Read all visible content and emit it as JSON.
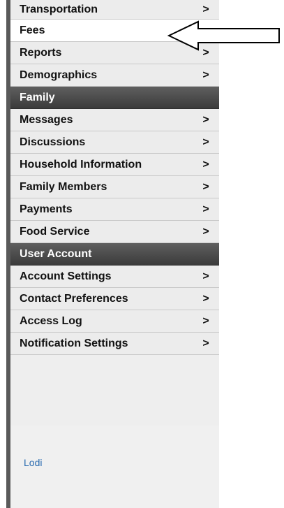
{
  "menu": {
    "top_items": [
      {
        "label": "Transportation",
        "chevron": ">"
      },
      {
        "label": "Fees",
        "chevron": ""
      },
      {
        "label": "Reports",
        "chevron": ">"
      },
      {
        "label": "Demographics",
        "chevron": ">"
      }
    ],
    "family_header": "Family",
    "family_items": [
      {
        "label": "Messages",
        "chevron": ">"
      },
      {
        "label": "Discussions",
        "chevron": ">"
      },
      {
        "label": "Household Information",
        "chevron": ">"
      },
      {
        "label": "Family Members",
        "chevron": ">"
      },
      {
        "label": "Payments",
        "chevron": ">"
      },
      {
        "label": "Food Service",
        "chevron": ">"
      }
    ],
    "account_header": "User Account",
    "account_items": [
      {
        "label": "Account Settings",
        "chevron": ">"
      },
      {
        "label": "Contact Preferences",
        "chevron": ">"
      },
      {
        "label": "Access Log",
        "chevron": ">"
      },
      {
        "label": "Notification Settings",
        "chevron": ">"
      }
    ]
  },
  "footer": {
    "link": "Lodi"
  },
  "annotation": {
    "icon": "left-arrow-icon",
    "color": "#000000"
  }
}
